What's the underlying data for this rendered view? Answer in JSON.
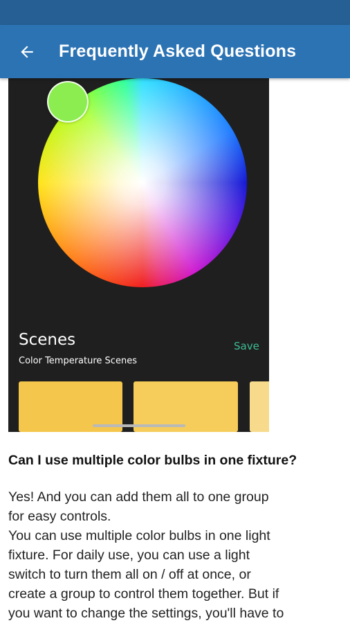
{
  "app_bar": {
    "title": "Frequently Asked Questions",
    "back_icon": "arrow-back-icon"
  },
  "colors": {
    "status_bar": "#255f94",
    "app_bar": "#2c73b4",
    "screenshot_bg": "#1f1f1f",
    "save_accent": "#3dbd94"
  },
  "embedded_screenshot": {
    "scenes_title": "Scenes",
    "scenes_subtitle": "Color Temperature Scenes",
    "save_label": "Save"
  },
  "faq": {
    "question": "Can I use multiple color bulbs in one fixture?",
    "answer_lines": [
      "Yes! And you can add them all to one group",
      "for easy controls.",
      "You can use multiple color bulbs in one light",
      "fixture. For daily use, you can use a light",
      "switch to turn them all on / off at once, or",
      "create a group to control them together. But if",
      "you want to change the settings, you'll have to"
    ]
  }
}
